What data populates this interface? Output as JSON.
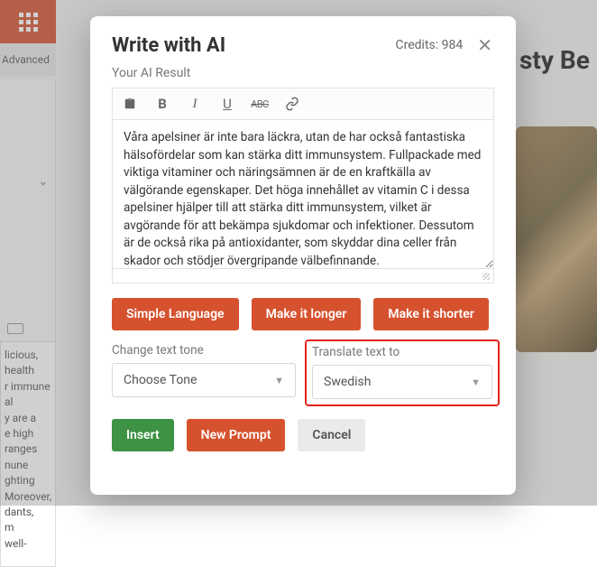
{
  "background": {
    "advanced_label": "Advanced",
    "page_title": "sty Be",
    "left_text": "licious,\nhealth\nr immune\nal\ny are a\ne high\nranges\nnune\nghting\nMoreover,\ndants,\nm\nwell-"
  },
  "modal": {
    "title": "Write with AI",
    "credits_text": "Credits: 984",
    "result_label": "Your AI Result",
    "editor_text": "Våra apelsiner är inte bara läckra, utan de har också fantastiska hälsofördelar som kan stärka ditt immunsystem. Fullpackade med viktiga vitaminer och näringsämnen är de en kraftkälla av välgörande egenskaper. Det höga innehållet av vitamin C i dessa apelsiner hjälper till att stärka ditt immunsystem, vilket är avgörande för att bekämpa sjukdomar och infektioner. Dessutom är de också rika på antioxidanter, som skyddar dina celler från skador och stödjer övergripande välbefinnande.",
    "buttons": {
      "simple": "Simple Language",
      "longer": "Make it longer",
      "shorter": "Make it shorter",
      "insert": "Insert",
      "new_prompt": "New Prompt",
      "cancel": "Cancel"
    },
    "tone": {
      "label": "Change text tone",
      "selected": "Choose Tone"
    },
    "translate": {
      "label": "Translate text to",
      "selected": "Swedish"
    }
  }
}
